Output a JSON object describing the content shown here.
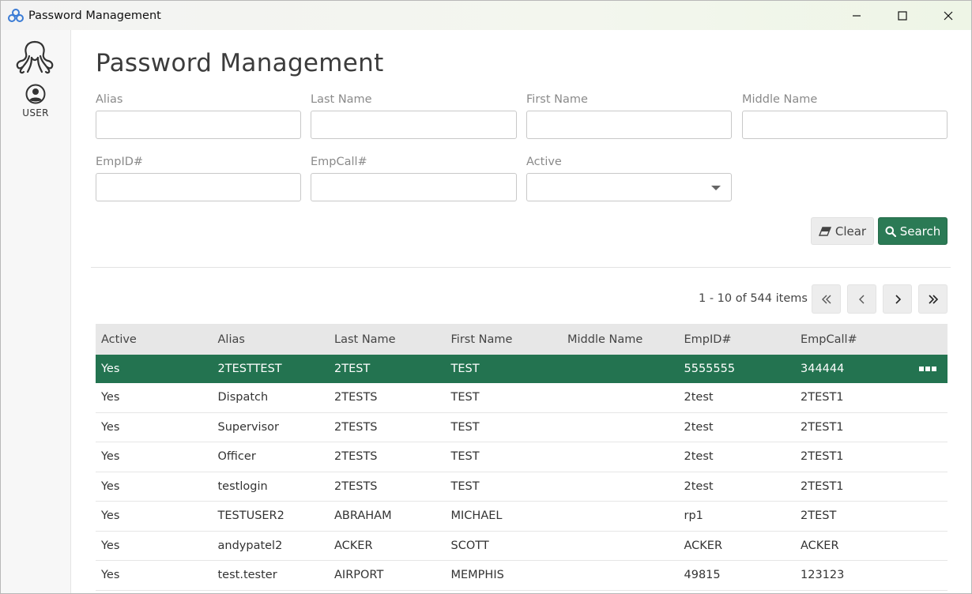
{
  "window": {
    "title": "Password Management",
    "controls": [
      "minimize",
      "maximize",
      "close"
    ]
  },
  "sidebar": {
    "logo_icon": "octopus-logo-icon",
    "items": [
      {
        "label": "USER",
        "icon": "user-circle-icon"
      }
    ]
  },
  "page": {
    "title": "Password Management"
  },
  "filters": {
    "alias": {
      "label": "Alias",
      "value": "",
      "placeholder": ""
    },
    "last_name": {
      "label": "Last Name",
      "value": "",
      "placeholder": ""
    },
    "first_name": {
      "label": "First Name",
      "value": "",
      "placeholder": ""
    },
    "middle_name": {
      "label": "Middle Name",
      "value": "",
      "placeholder": ""
    },
    "emp_id": {
      "label": "EmpID#",
      "value": "",
      "placeholder": ""
    },
    "emp_call": {
      "label": "EmpCall#",
      "value": "",
      "placeholder": ""
    },
    "active": {
      "label": "Active",
      "value": ""
    }
  },
  "actions": {
    "clear_label": "Clear",
    "search_label": "Search"
  },
  "pager": {
    "info": "1 - 10 of 544 items"
  },
  "grid": {
    "columns": [
      "Active",
      "Alias",
      "Last Name",
      "First Name",
      "Middle Name",
      "EmpID#",
      "EmpCall#"
    ],
    "rows": [
      {
        "active": "Yes",
        "alias": "2TESTTEST",
        "last_name": "2TEST",
        "first_name": "TEST",
        "middle_name": "",
        "emp_id": "5555555",
        "emp_call": "344444",
        "selected": true
      },
      {
        "active": "Yes",
        "alias": "Dispatch",
        "last_name": "2TESTS",
        "first_name": "TEST",
        "middle_name": "",
        "emp_id": "2test",
        "emp_call": "2TEST1"
      },
      {
        "active": "Yes",
        "alias": "Supervisor",
        "last_name": "2TESTS",
        "first_name": "TEST",
        "middle_name": "",
        "emp_id": "2test",
        "emp_call": "2TEST1"
      },
      {
        "active": "Yes",
        "alias": "Officer",
        "last_name": "2TESTS",
        "first_name": "TEST",
        "middle_name": "",
        "emp_id": "2test",
        "emp_call": "2TEST1"
      },
      {
        "active": "Yes",
        "alias": "testlogin",
        "last_name": "2TESTS",
        "first_name": "TEST",
        "middle_name": "",
        "emp_id": "2test",
        "emp_call": "2TEST1"
      },
      {
        "active": "Yes",
        "alias": "TESTUSER2",
        "last_name": "ABRAHAM",
        "first_name": "MICHAEL",
        "middle_name": "",
        "emp_id": "rp1",
        "emp_call": "2TEST"
      },
      {
        "active": "Yes",
        "alias": "andypatel2",
        "last_name": "ACKER",
        "first_name": "SCOTT",
        "middle_name": "",
        "emp_id": "ACKER",
        "emp_call": "ACKER"
      },
      {
        "active": "Yes",
        "alias": "test.tester",
        "last_name": "AIRPORT",
        "first_name": "MEMPHIS",
        "middle_name": "",
        "emp_id": "49815",
        "emp_call": "123123"
      }
    ]
  },
  "colors": {
    "accent": "#2b7a55",
    "selected_row": "#237350",
    "header_bg": "#e7e7e7"
  }
}
